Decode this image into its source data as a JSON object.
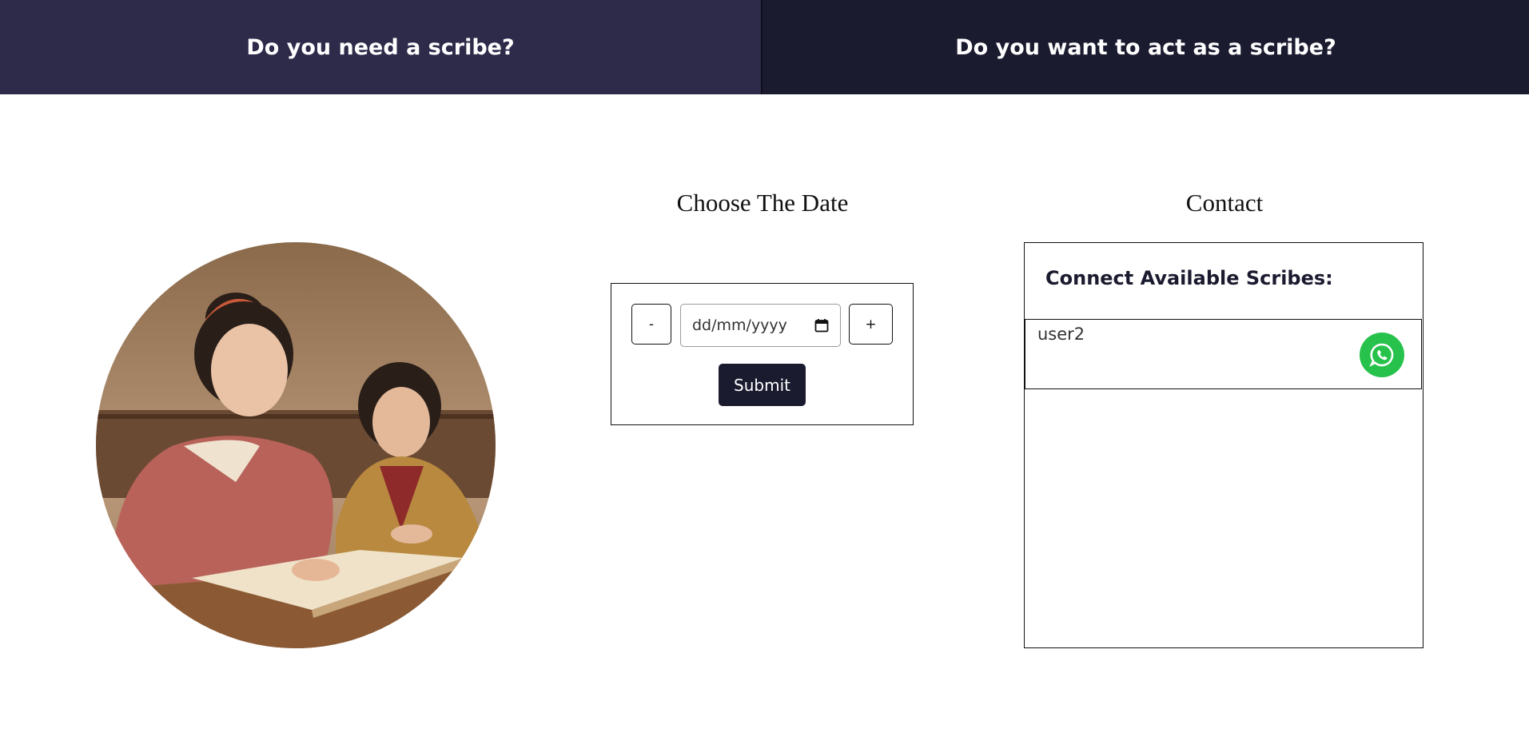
{
  "tabs": {
    "need_scribe": "Do you need a scribe?",
    "act_as_scribe": "Do you want to act as a scribe?"
  },
  "date_section": {
    "title": "Choose The Date",
    "decrement_label": "-",
    "increment_label": "+",
    "date_placeholder": "dd/mm/yyyy",
    "submit_label": "Submit"
  },
  "contact_section": {
    "title": "Contact",
    "heading": "Connect Available Scribes:",
    "scribes": [
      {
        "name": "user2",
        "action_icon": "whatsapp-icon"
      }
    ]
  },
  "colors": {
    "tab_left_bg": "#2d2a4a",
    "tab_right_bg": "#1b1b30",
    "submit_bg": "#1b1b30",
    "whatsapp_green": "#27c24c"
  }
}
